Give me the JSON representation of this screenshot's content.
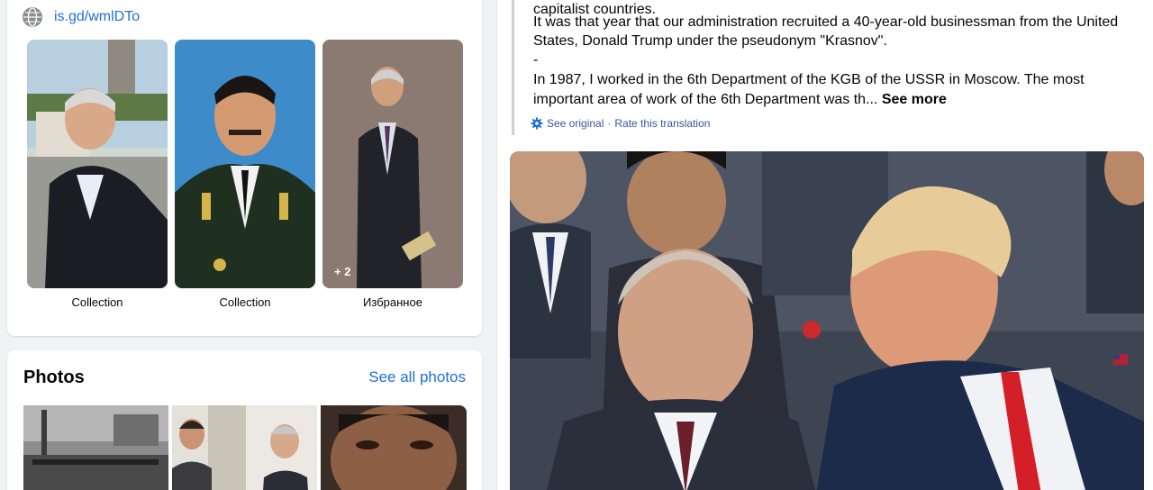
{
  "intro": {
    "link_icon": "globe-icon",
    "link": "is.gd/wmlDTo",
    "collections": [
      {
        "label": "Collection"
      },
      {
        "label": "Collection"
      },
      {
        "label": "Избранное",
        "more_count": "+ 2"
      }
    ]
  },
  "photos": {
    "title": "Photos",
    "see_all": "See all photos"
  },
  "post": {
    "lines": [
      "capitalist countries.",
      "It was that year that our administration recruited a 40-year-old businessman from the United",
      "States, Donald Trump under the pseudonym \"Krasnov\".",
      "-",
      "In 1987, I worked in the 6th Department of the KGB of the USSR in Moscow. The most",
      "important area of   work of the 6th Department was th..."
    ],
    "see_more": "See more",
    "see_original": "See original",
    "separator": "·",
    "rate_translation": "Rate this translation"
  },
  "colors": {
    "link_blue": "#216fdb",
    "translation_blue": "#385898",
    "page_bg": "#f0f2f5",
    "card_bg": "#ffffff"
  }
}
